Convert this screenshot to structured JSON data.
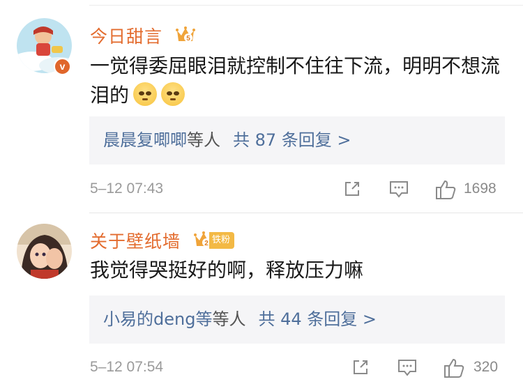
{
  "comments": [
    {
      "username": "今日甜言",
      "crown_level": "5",
      "verified_badge": "v",
      "text": "一觉得委屈眼泪就控制不住往下流，明明不想流泪的",
      "emojis": [
        "pleading-face",
        "pleading-face"
      ],
      "replies": {
        "people": "晨晨复唧唧",
        "suffix": "等人",
        "count": "共 87 条回复 >"
      },
      "time": "5–12 07:43",
      "likes": "1698"
    },
    {
      "username": "关于壁纸墙",
      "crown_level": "2",
      "fan_tag": "铁粉",
      "text": "我觉得哭挺好的啊，释放压力嘛",
      "replies": {
        "people": "小易的deng等",
        "suffix": "等人",
        "count": "共 44 条回复 >"
      },
      "time": "5–12 07:54",
      "likes": "320"
    }
  ],
  "colors": {
    "username": "#e36c2f",
    "link": "#4f6f9b",
    "reply_bg": "#f5f5f7",
    "meta": "#9a9a9a"
  }
}
